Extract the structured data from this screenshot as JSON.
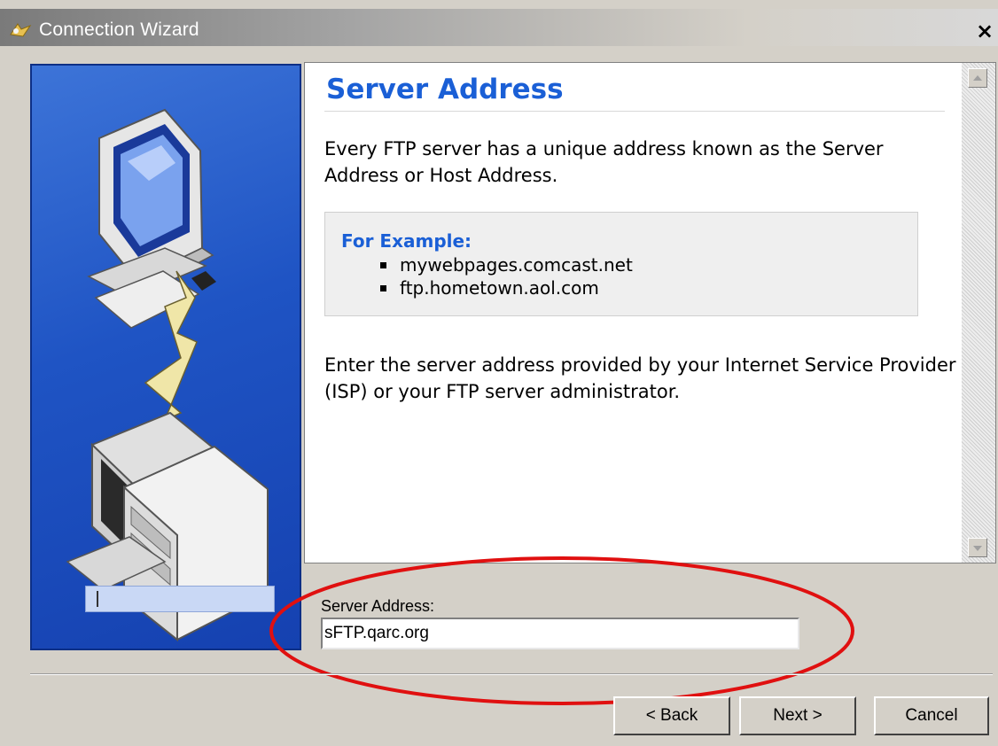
{
  "window": {
    "title": "Connection Wizard",
    "close_label": "×"
  },
  "page": {
    "heading": "Server Address",
    "intro": "Every FTP server has a unique address known as the Server Address or Host Address.",
    "example": {
      "title": "For Example:",
      "items": [
        "mywebpages.comcast.net",
        "ftp.hometown.aol.com"
      ]
    },
    "instruction": "Enter the server address provided by your Internet Service Provider (ISP) or your FTP server administrator."
  },
  "form": {
    "server_address_label": "Server Address:",
    "server_address_value": "sFTP.qarc.org"
  },
  "buttons": {
    "back": "< Back",
    "next": "Next >",
    "cancel": "Cancel"
  },
  "colors": {
    "heading": "#1a5fd6",
    "illustration_bg": "#1f54c4",
    "highlight": "#e01010"
  },
  "icons": [
    "wizard-icon",
    "close-icon",
    "scroll-up-icon",
    "scroll-down-icon"
  ]
}
